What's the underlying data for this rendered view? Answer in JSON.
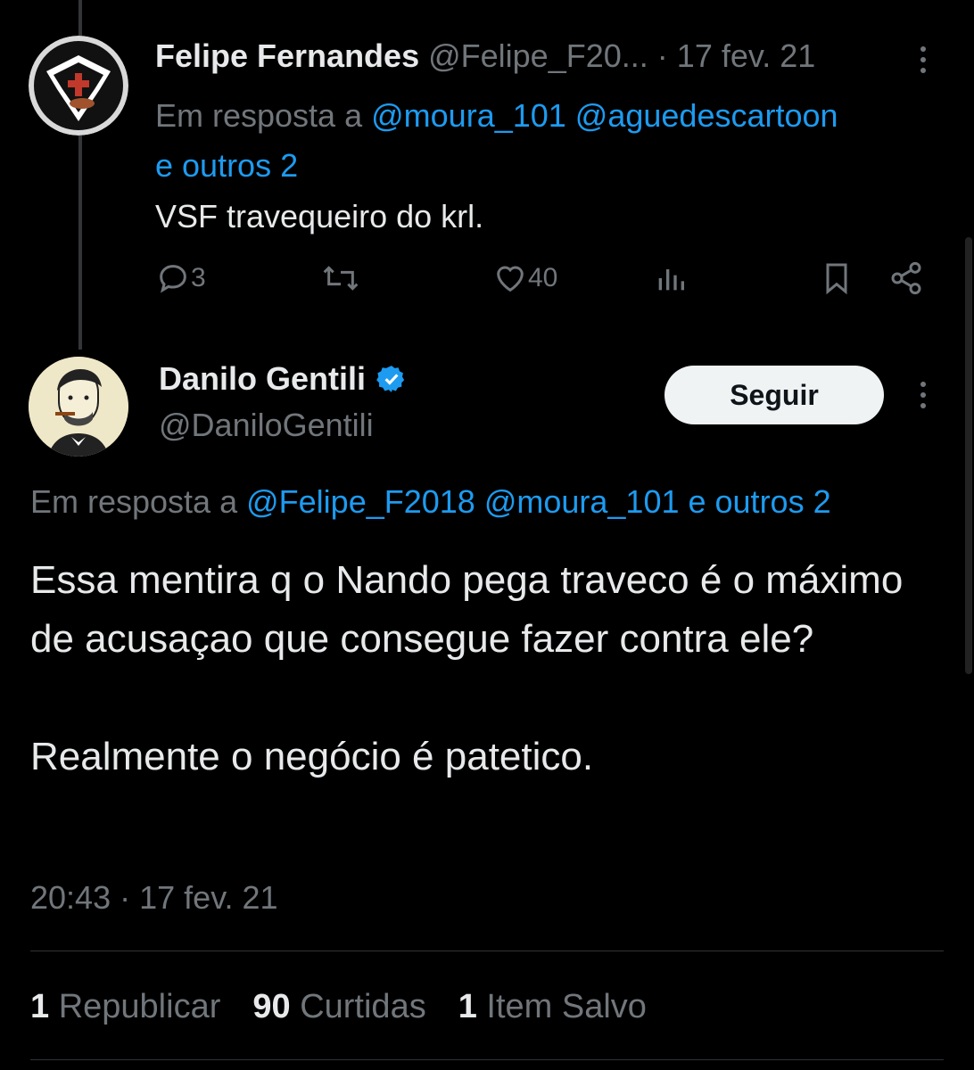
{
  "reply": {
    "display_name": "Felipe Fernandes",
    "handle": "@Felipe_F20...",
    "separator": "·",
    "date": "17 fev. 21",
    "in_reply_prefix": "Em resposta a",
    "in_reply_mentions": "@moura_101 @aguedescartoon",
    "in_reply_more": "e outros 2",
    "text": "VSF travequeiro do krl.",
    "actions": {
      "reply_count": "3",
      "repost_count": "",
      "like_count": "40"
    }
  },
  "main_tweet": {
    "display_name": "Danilo Gentili",
    "handle": "@DaniloGentili",
    "follow_label": "Seguir",
    "in_reply_prefix": "Em resposta a",
    "in_reply_mentions": "@Felipe_F2018 @moura_101 e outros 2",
    "paragraph1": "Essa mentira q o Nando pega traveco é o máximo de acusaçao que consegue fazer contra ele?",
    "paragraph2": "Realmente o negócio é patetico.",
    "time": "20:43",
    "separator": "·",
    "date": "17 fev. 21",
    "stats": {
      "reposts_count": "1",
      "reposts_label": "Republicar",
      "likes_count": "90",
      "likes_label": "Curtidas",
      "saves_count": "1",
      "saves_label": "Item Salvo"
    }
  },
  "colors": {
    "background": "#000000",
    "text": "#e7e9ea",
    "muted": "#71767b",
    "link": "#1d9bf0",
    "verified": "#1d9bf0",
    "button_bg": "#eff3f4"
  },
  "icons": [
    "reply-icon",
    "repost-icon",
    "like-icon",
    "views-icon",
    "bookmark-icon",
    "share-icon",
    "verified-badge-icon",
    "more-options-icon"
  ]
}
